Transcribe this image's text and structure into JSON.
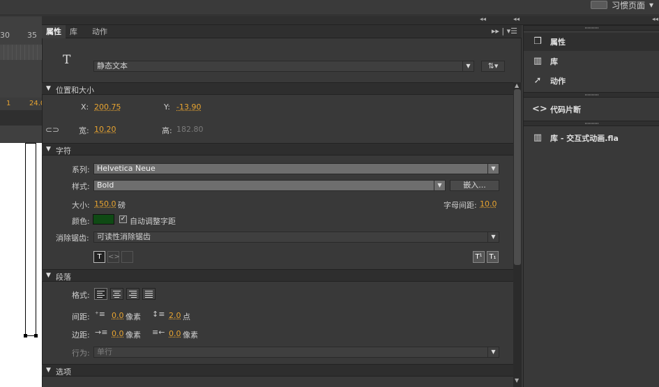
{
  "workspace": {
    "label": "习惯页面"
  },
  "timeline": {
    "ruler": [
      "30",
      "35"
    ],
    "status": {
      "frame": "1",
      "fps": "24.0"
    }
  },
  "panel": {
    "tabs": [
      {
        "label": "属性",
        "active": true
      },
      {
        "label": "库",
        "active": false
      },
      {
        "label": "动作",
        "active": false
      }
    ],
    "text_type": "静态文本",
    "sections": {
      "position": "位置和大小",
      "character": "字符",
      "paragraph": "段落",
      "options": "选项"
    },
    "position": {
      "x_label": "X:",
      "x_value": "200.75",
      "y_label": "Y:",
      "y_value": "-13.90",
      "w_label": "宽:",
      "w_value": "10.20",
      "h_label": "高:",
      "h_value": "182.80"
    },
    "character": {
      "family_label": "系列:",
      "family_value": "Helvetica Neue",
      "style_label": "样式:",
      "style_value": "Bold",
      "embed_button": "嵌入...",
      "size_label": "大小:",
      "size_value": "150.0",
      "size_unit": "磅",
      "spacing_label": "字母间距:",
      "spacing_value": "10.0",
      "color_label": "颜色:",
      "color_value": "#0f4a14",
      "auto_kern_label": "自动调整字距",
      "auto_kern_checked": true,
      "aa_label": "消除锯齿:",
      "aa_value": "可读性消除锯齿"
    },
    "paragraph": {
      "format_label": "格式:",
      "spacing_label": "间距:",
      "indent_value": "0.0",
      "indent_unit": "像素",
      "line_value": "2.0",
      "line_unit": "点",
      "margin_label": "边距:",
      "left_margin_value": "0.0",
      "left_margin_unit": "像素",
      "right_margin_value": "0.0",
      "right_margin_unit": "像素",
      "behavior_label": "行为:",
      "behavior_value": "单行"
    }
  },
  "sidebar": {
    "items": [
      {
        "label": "属性",
        "icon": "properties-icon"
      },
      {
        "label": "库",
        "icon": "library-icon"
      },
      {
        "label": "动作",
        "icon": "actions-icon"
      },
      {
        "label": "代码片断",
        "icon": "code-snippets-icon"
      },
      {
        "label": "库 - 交互式动画.fla",
        "icon": "library-file-icon"
      }
    ]
  },
  "colors": {
    "accent_value": "#e8a430",
    "panel_bg": "#393939",
    "header_bg": "#2e2e2e"
  }
}
